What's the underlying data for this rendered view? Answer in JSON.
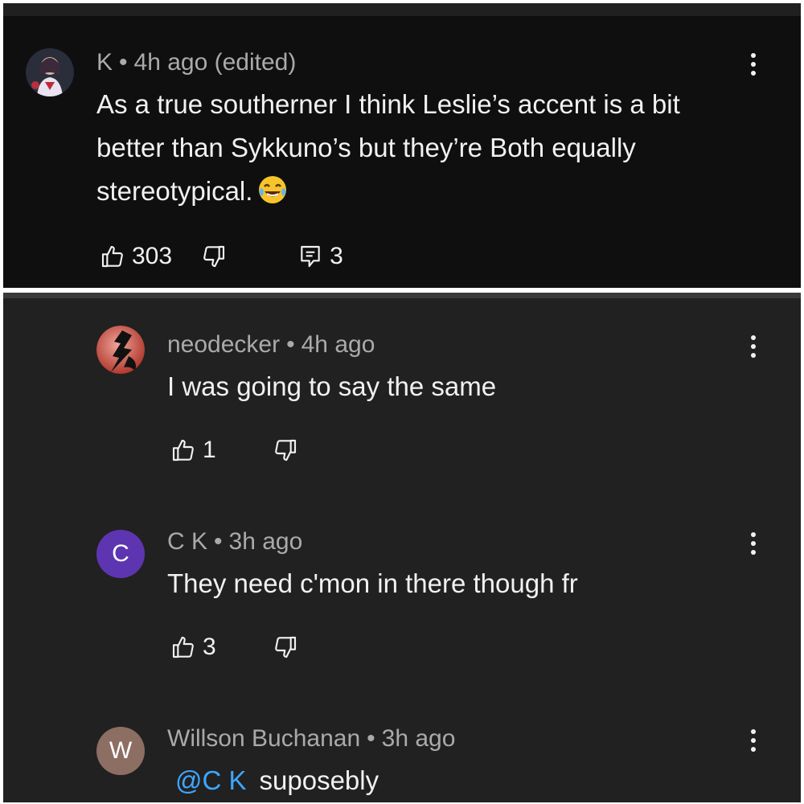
{
  "comments": [
    {
      "author": "K",
      "time": "4h ago (edited)",
      "text": "As a true southerner I think Leslie’s accent is a bit better than Sykkuno’s but they’re Both equally stereotypical.",
      "emoji": "face-with-tears-of-joy",
      "likes": "303",
      "replies": "3"
    }
  ],
  "replies": [
    {
      "author": "neodecker",
      "time": "4h ago",
      "text": "I was going to say the same",
      "likes": "1"
    },
    {
      "author": "C K",
      "time": "3h ago",
      "text": "They need c'mon in there though fr",
      "likes": "3",
      "avatar_letter": "C",
      "avatar_color": "#5e35b1"
    },
    {
      "author": "Willson Buchanan",
      "time": "3h ago",
      "mention": "@C K",
      "text": "suposebly",
      "avatar_letter": "W",
      "avatar_color": "#8d6e63"
    }
  ],
  "colors": {
    "link": "#3ea6ff",
    "meta": "#aaaaaa",
    "text": "#f1f1f1"
  },
  "icons": [
    "thumb-up-icon",
    "thumb-down-icon",
    "reply-icon",
    "more-vert-icon"
  ]
}
